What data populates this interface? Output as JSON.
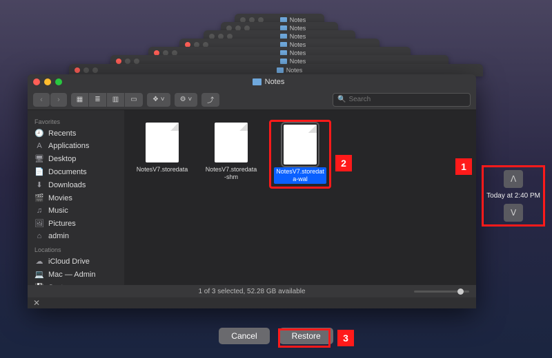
{
  "window": {
    "title": "Notes",
    "status": "1 of 3 selected, 52.28 GB available"
  },
  "search": {
    "placeholder": "Search"
  },
  "sidebar": {
    "favorites_heading": "Favorites",
    "locations_heading": "Locations",
    "favorites": [
      {
        "icon": "🕘",
        "label": "Recents"
      },
      {
        "icon": "A",
        "label": "Applications"
      },
      {
        "icon": "🖥",
        "label": "Desktop"
      },
      {
        "icon": "📄",
        "label": "Documents"
      },
      {
        "icon": "⬇",
        "label": "Downloads"
      },
      {
        "icon": "🎬",
        "label": "Movies"
      },
      {
        "icon": "♫",
        "label": "Music"
      },
      {
        "icon": "🖼",
        "label": "Pictures"
      },
      {
        "icon": "⌂",
        "label": "admin"
      }
    ],
    "locations": [
      {
        "icon": "☁",
        "label": "iCloud Drive"
      },
      {
        "icon": "💻",
        "label": "Mac — Admin"
      },
      {
        "icon": "💾",
        "label": "System"
      }
    ]
  },
  "files": [
    {
      "name": "NotesV7.storedata"
    },
    {
      "name": "NotesV7.storedata-shm"
    },
    {
      "name": "NotesV7.storedata-wal"
    }
  ],
  "timeline": {
    "label": "Today at 2:40 PM"
  },
  "buttons": {
    "cancel": "Cancel",
    "restore": "Restore"
  },
  "callouts": {
    "c1": "1",
    "c2": "2",
    "c3": "3"
  }
}
